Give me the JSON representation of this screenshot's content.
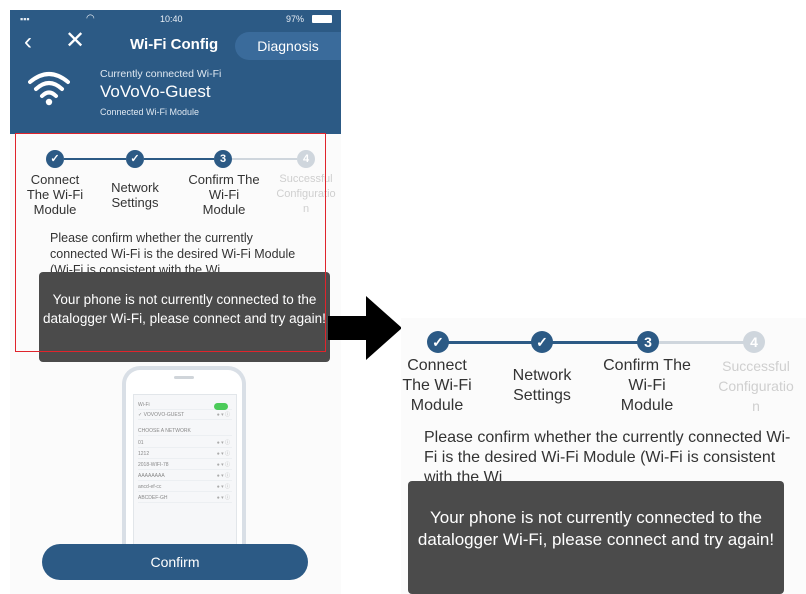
{
  "left": {
    "status": {
      "time": "10:40",
      "battery": "97%"
    },
    "nav": {
      "title": "Wi-Fi Config",
      "diagnosis": "Diagnosis"
    },
    "wifi": {
      "current_label": "Currently connected Wi-Fi",
      "ssid": "VoVoVo-Guest",
      "module_label": "Connected Wi-Fi Module"
    },
    "steps": [
      {
        "num": "✓",
        "label": "Connect\nThe Wi-Fi\nModule",
        "state": "done"
      },
      {
        "num": "✓",
        "label": "Network\nSettings",
        "state": "done"
      },
      {
        "num": "3",
        "label": "Confirm The\nWi-Fi\nModule",
        "state": "active"
      },
      {
        "num": "4",
        "label": "Successful\nConfiguratio\nn",
        "state": "pending"
      }
    ],
    "paragraph": "Please confirm whether the currently connected Wi-Fi is the desired Wi-Fi Module (Wi-Fi is consistent with the Wi",
    "toast": "Your phone is not currently connected to the datalogger Wi-Fi, please connect and try again!",
    "confirm_label": "Confirm",
    "mini_phone": {
      "rows": [
        {
          "text": "Wi-Fi",
          "right": ""
        },
        {
          "text": "✓ VOVOVO-GUEST",
          "right": "● ▾ ⓘ"
        },
        {
          "text": "CHOOSE A NETWORK",
          "right": ""
        },
        {
          "text": "01",
          "right": "● ▾ ⓘ"
        },
        {
          "text": "1212",
          "right": "● ▾ ⓘ"
        },
        {
          "text": "2018-WIFI-78",
          "right": "● ▾ ⓘ"
        },
        {
          "text": "AAAAAAAA",
          "right": "● ▾ ⓘ"
        },
        {
          "text": "ancd-ef-cc",
          "right": "● ▾ ⓘ"
        },
        {
          "text": "ABCDEF-GH",
          "right": "● ▾ ⓘ"
        }
      ]
    }
  },
  "right": {
    "steps": [
      {
        "num": "✓",
        "label": "Connect\nThe Wi-Fi\nModule",
        "state": "done"
      },
      {
        "num": "✓",
        "label": "Network\nSettings",
        "state": "done"
      },
      {
        "num": "3",
        "label": "Confirm The\nWi-Fi\nModule",
        "state": "active"
      },
      {
        "num": "4",
        "label": "Successful\nConfiguratio\nn",
        "state": "pending"
      }
    ],
    "paragraph": "Please confirm whether the currently connected Wi-Fi is the desired Wi-Fi Module (Wi-Fi is consistent with the Wi",
    "toast": "Your phone is not currently connected to the datalogger Wi-Fi, please connect and try again!"
  },
  "colors": {
    "brand": "#2c5a85",
    "highlight_border": "#e0242c",
    "toast_bg": "#4b4b4b",
    "inactive": "#cfd6dd"
  }
}
